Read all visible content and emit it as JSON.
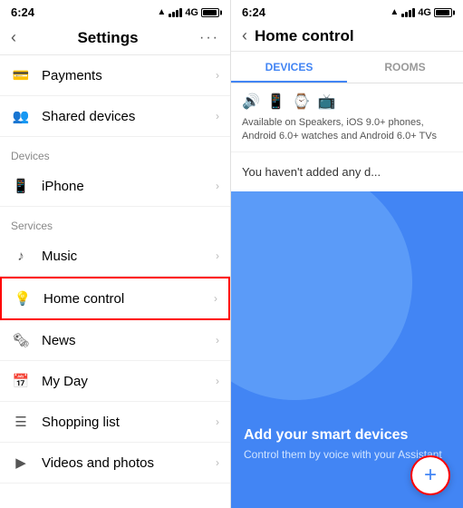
{
  "left": {
    "status": {
      "time": "6:24",
      "arrow": "▲",
      "signal_label": "4G"
    },
    "header": {
      "title": "Settings",
      "more": "···"
    },
    "sections": [
      {
        "label": "",
        "items": [
          {
            "id": "payments",
            "icon": "💳",
            "label": "Payments"
          },
          {
            "id": "shared-devices",
            "icon": "👥",
            "label": "Shared devices"
          }
        ]
      },
      {
        "label": "Devices",
        "items": [
          {
            "id": "iphone",
            "icon": "📱",
            "label": "iPhone"
          }
        ]
      },
      {
        "label": "Services",
        "items": [
          {
            "id": "music",
            "icon": "♪",
            "label": "Music"
          },
          {
            "id": "home-control",
            "icon": "💡",
            "label": "Home control",
            "highlighted": true
          },
          {
            "id": "news",
            "icon": "🗞",
            "label": "News"
          },
          {
            "id": "my-day",
            "icon": "📅",
            "label": "My Day"
          },
          {
            "id": "shopping-list",
            "icon": "☰",
            "label": "Shopping list"
          },
          {
            "id": "videos-photos",
            "icon": "▶",
            "label": "Videos and photos"
          }
        ]
      }
    ]
  },
  "right": {
    "status": {
      "time": "6:24",
      "arrow": "▲",
      "signal_label": "4G"
    },
    "header": {
      "title": "Home control"
    },
    "tabs": [
      {
        "id": "devices",
        "label": "DEVICES",
        "active": true
      },
      {
        "id": "rooms",
        "label": "ROOMS",
        "active": false
      }
    ],
    "devices_info": {
      "description": "Available on Speakers, iOS 9.0+ phones, Android 6.0+ watches and Android 6.0+ TVs"
    },
    "empty_text": "You haven't added any d...",
    "promo": {
      "title": "Add your smart devices",
      "subtitle": "Control them by voice\nwith your Assistant",
      "fab_label": "+"
    }
  }
}
